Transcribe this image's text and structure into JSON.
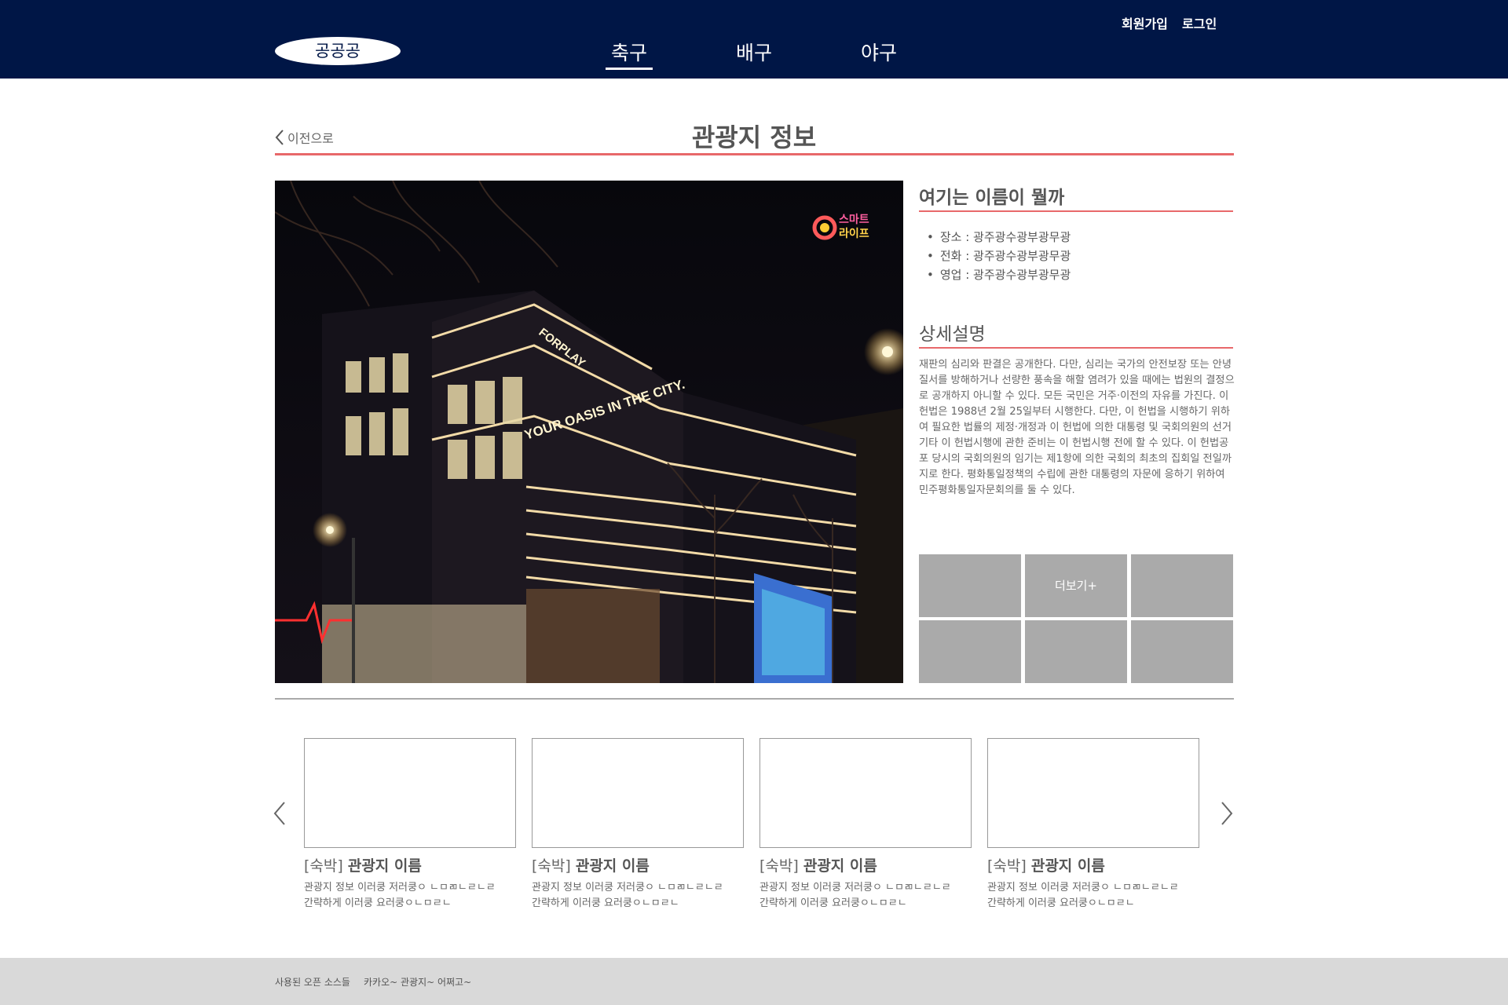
{
  "header": {
    "logo": "공공공",
    "nav": [
      "축구",
      "배구",
      "야구"
    ],
    "signup": "회원가입",
    "login": "로그인"
  },
  "title_bar": {
    "back": "이전으로",
    "title": "관광지 정보"
  },
  "photo": {
    "badge_line1": "스마트",
    "badge_line2": "라이프",
    "sign_main": "YOUR OASIS IN THE CITY.",
    "sign_top": "FORPLAY"
  },
  "info": {
    "name": "여기는 이름이 뭘까",
    "details": [
      "장소 : 광주광수광부광무광",
      "전화 : 광주광수광부광무광",
      "영업 : 광주광수광부광무광"
    ],
    "desc_heading": "상세설명",
    "desc_text": "재판의 심리와 판결은 공개한다. 다만, 심리는 국가의 안전보장 또는 안녕질서를 방해하거나 선량한 풍속을 해할 염려가 있을 때에는 법원의 결정으로 공개하지 아니할 수 있다. 모든 국민은 거주·이전의 자유를 가진다. 이 헌법은 1988년 2월 25일부터 시행한다. 다만, 이 헌법을 시행하기 위하여 필요한 법률의 제정·개정과 이 헌법에 의한 대통령 및 국회의원의 선거 기타 이 헌법시행에 관한 준비는 이 헌법시행 전에 할 수 있다. 이 헌법공포 당시의 국회의원의 임기는 제1항에 의한 국회의 최초의 집회일 전일까지로 한다. 평화통일정책의 수립에 관한 대통령의 자문에 응하기 위하여 민주평화통일자문회의를 둘 수 있다.",
    "more": "더보기+"
  },
  "cards": [
    {
      "tag": "[숙박]",
      "name": "관광지 이름",
      "line1": "관광지 정보 이러쿵 저러쿵ㅇ ㄴㅁㄻㄴㄹㄴㄹ",
      "line2": "간략하게 이러쿵 요러쿵ㅇㄴㅁㄹㄴ"
    },
    {
      "tag": "[숙박]",
      "name": "관광지 이름",
      "line1": "관광지 정보 이러쿵 저러쿵ㅇ ㄴㅁㄻㄴㄹㄴㄹ",
      "line2": "간략하게 이러쿵 요러쿵ㅇㄴㅁㄹㄴ"
    },
    {
      "tag": "[숙박]",
      "name": "관광지 이름",
      "line1": "관광지 정보 이러쿵 저러쿵ㅇ ㄴㅁㄻㄴㄹㄴㄹ",
      "line2": "간략하게 이러쿵 요러쿵ㅇㄴㅁㄹㄴ"
    },
    {
      "tag": "[숙박]",
      "name": "관광지 이름",
      "line1": "관광지 정보 이러쿵 저러쿵ㅇ ㄴㅁㄻㄴㄹㄴㄹ",
      "line2": "간략하게 이러쿵 요러쿵ㅇㄴㅁㄹㄴ"
    }
  ],
  "footer": {
    "open_source": "사용된 오픈 소스들",
    "credits": "카카오~ 관광지~ 어쩌고~"
  },
  "colors": {
    "header_bg": "#001646",
    "accent_rule": "#e8686a",
    "thumb_gray": "#aaaaaa",
    "footer_bg": "#d9d9d9"
  }
}
